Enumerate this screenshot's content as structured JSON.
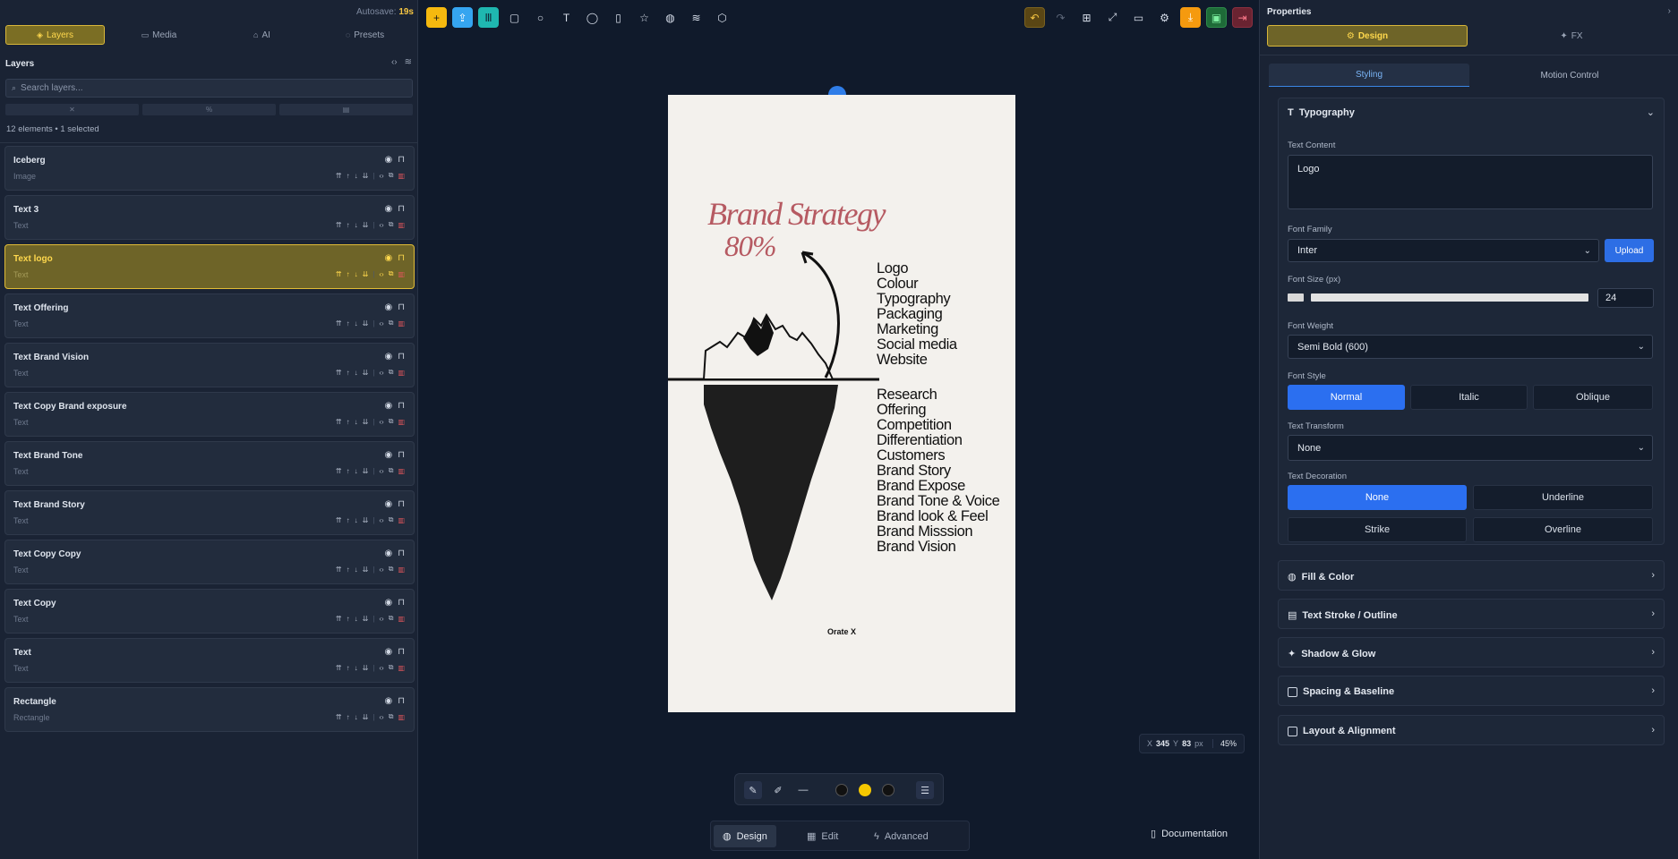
{
  "left": {
    "autosave_label": "Autosave:",
    "autosave_value": "19s",
    "tabs": [
      {
        "label": "Layers",
        "icon": "layers-icon"
      },
      {
        "label": "Media",
        "icon": "folder-icon"
      },
      {
        "label": "AI",
        "icon": "ai-icon"
      },
      {
        "label": "Presets",
        "icon": "presets-icon"
      }
    ],
    "layers_title": "Layers",
    "search_placeholder": "Search layers...",
    "element_count": "12 elements • 1 selected",
    "layers": [
      {
        "name": "Iceberg",
        "type": "Image"
      },
      {
        "name": "Text 3",
        "type": "Text"
      },
      {
        "name": "Text logo",
        "type": "Text",
        "selected": true
      },
      {
        "name": "Text Offering",
        "type": "Text"
      },
      {
        "name": "Text Brand Vision",
        "type": "Text"
      },
      {
        "name": "Text Copy Brand exposure",
        "type": "Text"
      },
      {
        "name": "Text Brand Tone",
        "type": "Text"
      },
      {
        "name": "Text Brand Story",
        "type": "Text"
      },
      {
        "name": "Text Copy Copy",
        "type": "Text"
      },
      {
        "name": "Text Copy",
        "type": "Text"
      },
      {
        "name": "Text",
        "type": "Text"
      },
      {
        "name": "Rectangle",
        "type": "Rectangle"
      }
    ]
  },
  "canvas": {
    "title": "Brand Strategy",
    "percent": "80%",
    "list_top": [
      "Logo",
      "Colour",
      "Typography",
      "Packaging",
      "Marketing",
      "Social media",
      "Website"
    ],
    "list_bottom": [
      "Research",
      "Offering",
      "Competition",
      "Differentiation",
      "Customers",
      "Brand Story",
      "Brand Expose",
      "Brand Tone & Voice",
      "Brand look & Feel",
      "Brand Misssion",
      "Brand Vision"
    ],
    "footer": "Orate X",
    "coord_x_label": "X",
    "coord_x": "345",
    "coord_y_label": "Y",
    "coord_y": "83",
    "coord_unit": "px",
    "zoom": "45%"
  },
  "drawbar": {
    "colors": [
      "#111111",
      "#f5c800",
      "#111111"
    ]
  },
  "modes": [
    {
      "label": "Design",
      "icon": "palette-icon"
    },
    {
      "label": "Edit",
      "icon": "film-icon"
    },
    {
      "label": "Advanced",
      "icon": "bolt-icon"
    }
  ],
  "documentation": "Documentation",
  "right": {
    "title": "Properties",
    "tabs": [
      {
        "label": "Design"
      },
      {
        "label": "FX"
      }
    ],
    "subtabs": [
      "Styling",
      "Motion Control"
    ],
    "typography": {
      "heading": "Typography",
      "text_content_label": "Text Content",
      "text_content": "Logo",
      "font_family_label": "Font Family",
      "font_family": "Inter",
      "upload": "Upload",
      "font_size_label": "Font Size (px)",
      "font_size": "24",
      "font_weight_label": "Font Weight",
      "font_weight": "Semi Bold (600)",
      "font_style_label": "Font Style",
      "font_styles": [
        "Normal",
        "Italic",
        "Oblique"
      ],
      "text_transform_label": "Text Transform",
      "text_transform": "None",
      "text_decoration_label": "Text Decoration",
      "decorations": [
        "None",
        "Underline",
        "Strike",
        "Overline"
      ]
    },
    "sections": [
      "Fill & Color",
      "Text Stroke / Outline",
      "Shadow & Glow",
      "Spacing & Baseline",
      "Layout & Alignment"
    ]
  },
  "colors": {
    "accent_yellow": "#ffd84d",
    "accent_blue": "#2b6ff0",
    "brand_text": "#b65a62"
  }
}
